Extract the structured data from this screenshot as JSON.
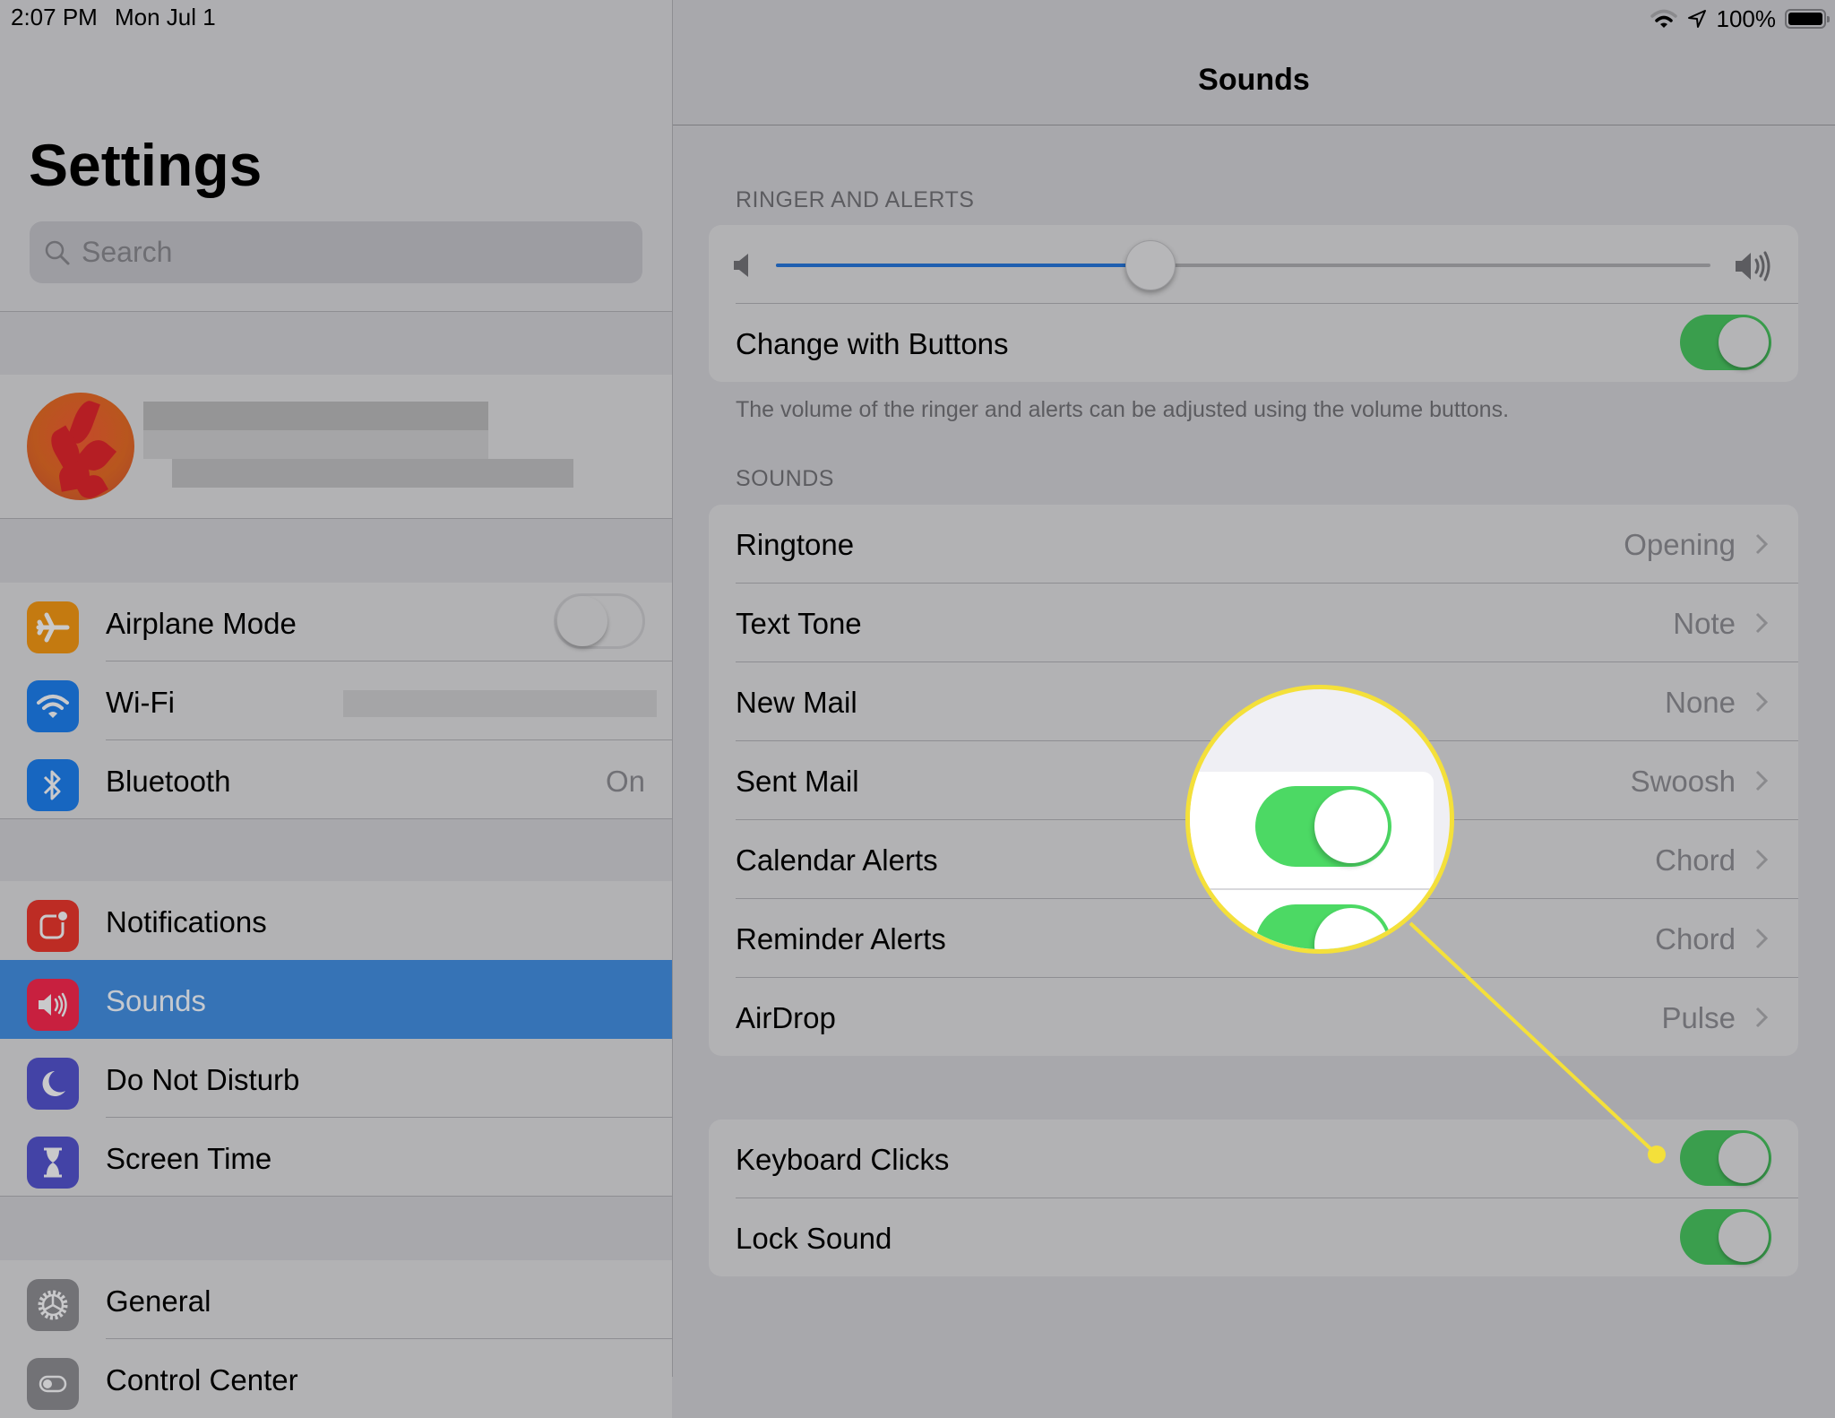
{
  "status_bar": {
    "time": "2:07 PM",
    "date": "Mon Jul 1",
    "battery_percent": "100%",
    "icons": [
      "wifi-icon",
      "location-icon",
      "battery-icon"
    ]
  },
  "sidebar": {
    "title": "Settings",
    "search": {
      "placeholder": "Search",
      "value": ""
    },
    "profile": {
      "name": "[redacted]",
      "subtitle": "[redacted]"
    },
    "groups": [
      [
        {
          "label": "Airplane Mode",
          "icon": "airplane-icon",
          "color": "#c47a10",
          "control": "switch",
          "on": false
        },
        {
          "label": "Wi-Fi",
          "icon": "wifi-icon",
          "color": "#1766c0",
          "value": "[redacted]"
        },
        {
          "label": "Bluetooth",
          "icon": "bluetooth-icon",
          "color": "#1766c0",
          "value": "On"
        }
      ],
      [
        {
          "label": "Notifications",
          "icon": "notifications-icon",
          "color": "#bd2c24"
        },
        {
          "label": "Sounds",
          "icon": "speaker-icon",
          "color": "#c8203f",
          "selected": true
        },
        {
          "label": "Do Not Disturb",
          "icon": "moon-icon",
          "color": "#4343a6"
        },
        {
          "label": "Screen Time",
          "icon": "hourglass-icon",
          "color": "#4343a6"
        }
      ],
      [
        {
          "label": "General",
          "icon": "gear-icon",
          "color": "#727276"
        },
        {
          "label": "Control Center",
          "icon": "control-center-icon",
          "color": "#727276"
        }
      ]
    ],
    "selected_color": "#3673b6"
  },
  "detail": {
    "title": "Sounds",
    "ringer_section": {
      "header": "RINGER AND ALERTS",
      "volume_fraction": 0.4,
      "change_with_buttons": {
        "label": "Change with Buttons",
        "on": true
      },
      "footer": "The volume of the ringer and alerts can be adjusted using the volume buttons."
    },
    "sounds_section": {
      "header": "SOUNDS",
      "rows": [
        {
          "label": "Ringtone",
          "value": "Opening"
        },
        {
          "label": "Text Tone",
          "value": "Note"
        },
        {
          "label": "New Mail",
          "value": "None"
        },
        {
          "label": "Sent Mail",
          "value": "Swoosh"
        },
        {
          "label": "Calendar Alerts",
          "value": "Chord"
        },
        {
          "label": "Reminder Alerts",
          "value": "Chord"
        },
        {
          "label": "AirDrop",
          "value": "Pulse"
        }
      ]
    },
    "toggles_section": {
      "rows": [
        {
          "label": "Keyboard Clicks",
          "on": true
        },
        {
          "label": "Lock Sound",
          "on": true
        }
      ]
    }
  },
  "annotation": {
    "type": "magnifier-callout",
    "target": "Keyboard Clicks switch",
    "color": "#f4e03a",
    "switch_color": "#4cd964"
  }
}
